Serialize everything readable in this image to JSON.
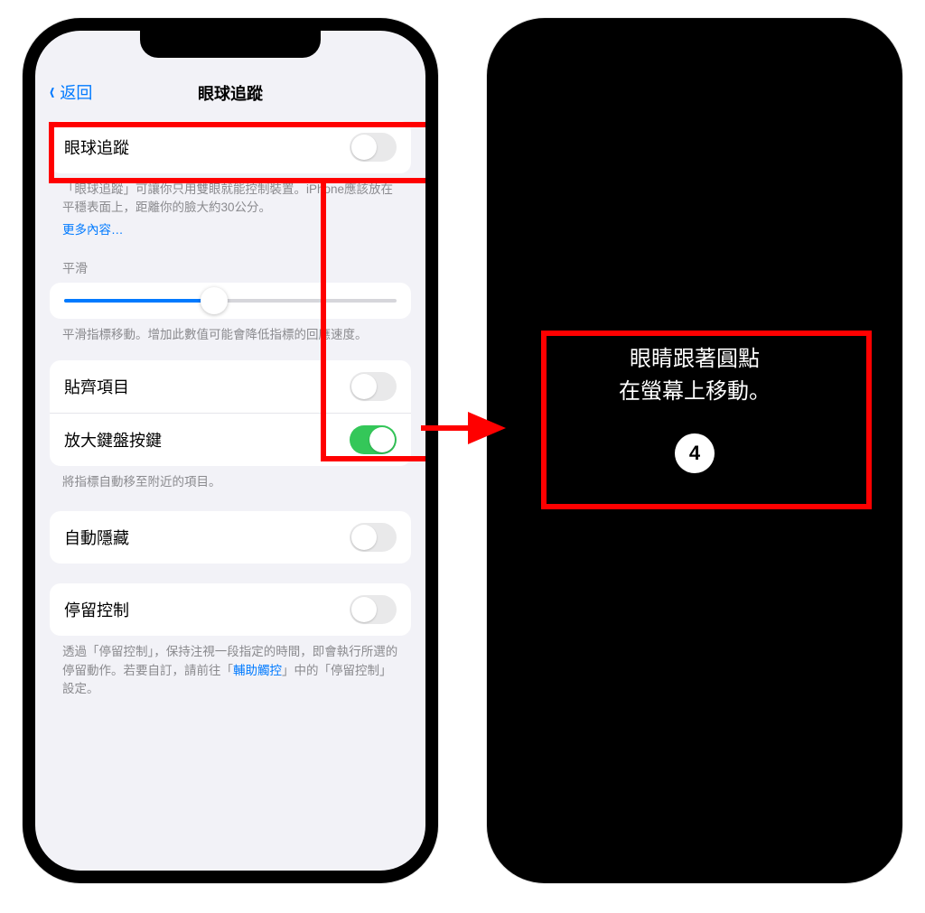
{
  "left": {
    "nav": {
      "back": "返回",
      "title": "眼球追蹤"
    },
    "main_toggle": {
      "label": "眼球追蹤",
      "on": false
    },
    "main_desc": "「眼球追蹤」可讓你只用雙眼就能控制裝置。iPhone應該放在平穩表面上，距離你的臉大約30公分。",
    "more": "更多內容…",
    "slider": {
      "label": "平滑",
      "desc": "平滑指標移動。增加此數值可能會降低指標的回應速度。"
    },
    "group2": {
      "snap": {
        "label": "貼齊項目",
        "on": false
      },
      "zoom": {
        "label": "放大鍵盤按鍵",
        "on": true
      },
      "desc": "將指標自動移至附近的項目。"
    },
    "group3": {
      "auto_hide": {
        "label": "自動隱藏",
        "on": false
      }
    },
    "group4": {
      "dwell": {
        "label": "停留控制",
        "on": false
      },
      "desc_pre": "透過「停留控制」，保持注視一段指定的時間，即會執行所選的停留動作。若要自訂，請前往「",
      "desc_link": "輔助觸控",
      "desc_post": "」中的「停留控制」設定。"
    }
  },
  "right": {
    "line1": "眼睛跟著圓點",
    "line2": "在螢幕上移動。",
    "count": "4"
  }
}
